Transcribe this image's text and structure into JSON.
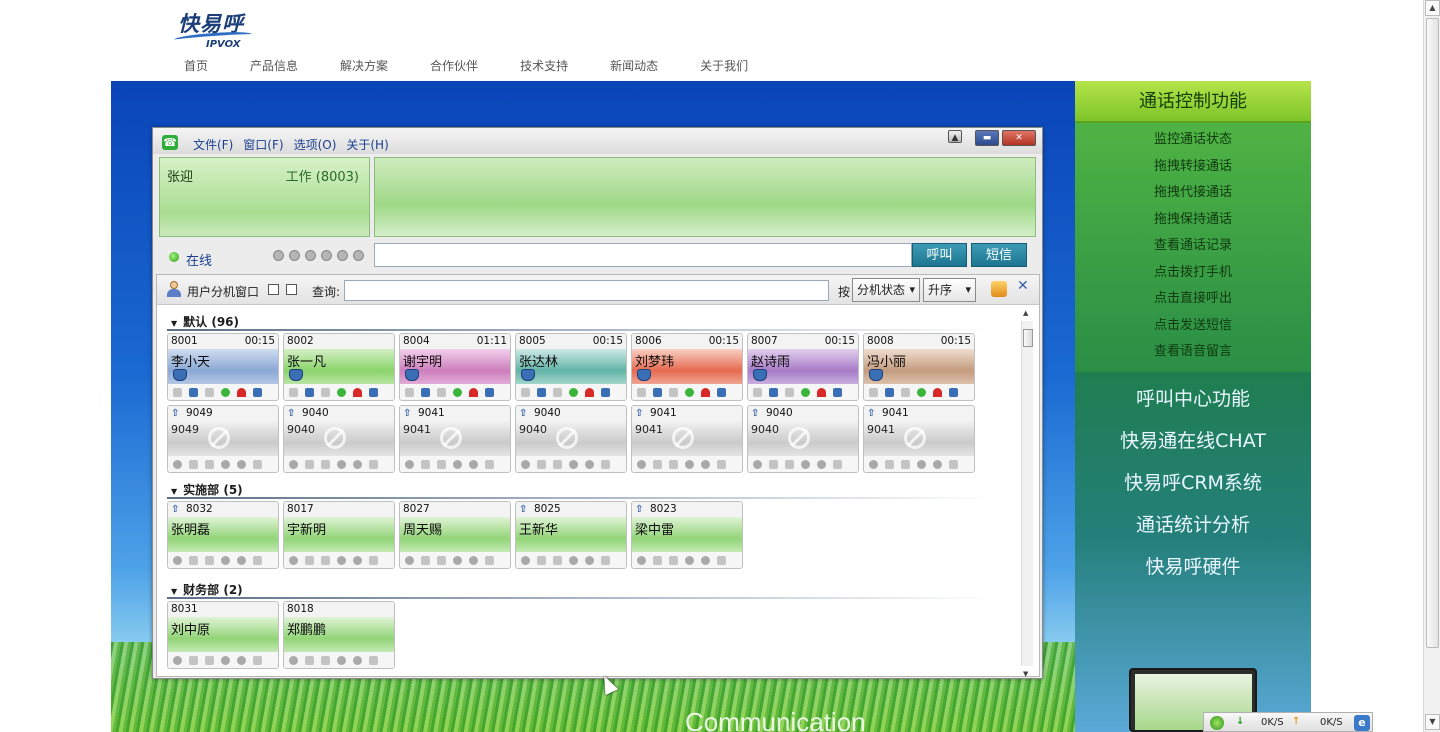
{
  "site": {
    "logo_text": "快易呼",
    "logo_sub": "IPVOX",
    "nav": [
      "首页",
      "产品信息",
      "解决方案",
      "合作伙伴",
      "技术支持",
      "新闻动态",
      "关于我们"
    ]
  },
  "hero": {
    "overlay_text": "Communication"
  },
  "right_panel": {
    "title": "通话控制功能",
    "sub_items": [
      "监控通话状态",
      "拖拽转接通话",
      "拖拽代接通话",
      "拖拽保持通话",
      "查看通话记录",
      "点击拨打手机",
      "点击直接呼出",
      "点击发送短信",
      "查看语音留言"
    ],
    "big_items": [
      "呼叫中心功能",
      "快易通在线CHAT",
      "快易呼CRM系统",
      "通话统计分析",
      "快易呼硬件"
    ]
  },
  "app": {
    "menu": [
      "文件(F)",
      "窗口(F)",
      "选项(O)",
      "关于(H)"
    ],
    "window_buttons": {
      "minimize": "▬",
      "close": "✕",
      "restore": "▲"
    },
    "user": {
      "name": "张迎",
      "status": "工作 (8003)"
    },
    "presence": "在线",
    "call_button": "呼叫",
    "sms_button": "短信"
  },
  "ext_panel": {
    "title": "用户分机窗口",
    "query_label": "查询:",
    "by_label": "按",
    "sort_field": "分机状态",
    "sort_order": "升序",
    "close": "✕",
    "groups": [
      {
        "header": "默认 (96)",
        "cards": [
          {
            "ext": "8001",
            "time": "00:15",
            "name": "李小天",
            "color": "blue",
            "active": true
          },
          {
            "ext": "8002",
            "time": "",
            "name": "张一凡",
            "color": "green",
            "active": true
          },
          {
            "ext": "8004",
            "time": "01:11",
            "name": "谢宇明",
            "color": "pink",
            "active": true
          },
          {
            "ext": "8005",
            "time": "00:15",
            "name": "张达林",
            "color": "teal",
            "active": true
          },
          {
            "ext": "8006",
            "time": "00:15",
            "name": "刘梦玮",
            "color": "red",
            "active": true
          },
          {
            "ext": "8007",
            "time": "00:15",
            "name": "赵诗雨",
            "color": "purple",
            "active": true
          },
          {
            "ext": "8008",
            "time": "00:15",
            "name": "冯小丽",
            "color": "tan",
            "active": true
          },
          {
            "ext": "9049",
            "name": "9049",
            "color": "grey",
            "active": false
          },
          {
            "ext": "9040",
            "name": "9040",
            "color": "grey",
            "active": false
          },
          {
            "ext": "9041",
            "name": "9041",
            "color": "grey",
            "active": false
          },
          {
            "ext": "9040",
            "name": "9040",
            "color": "grey",
            "active": false
          },
          {
            "ext": "9041",
            "name": "9041",
            "color": "grey",
            "active": false
          },
          {
            "ext": "9040",
            "name": "9040",
            "color": "grey",
            "active": false
          },
          {
            "ext": "9041",
            "name": "9041",
            "color": "grey",
            "active": false
          }
        ]
      },
      {
        "header": "实施部 (5)",
        "cards": [
          {
            "ext": "8032",
            "name": "张明磊",
            "color": "lgreen",
            "arrow": true
          },
          {
            "ext": "8017",
            "name": "宇新明",
            "color": "lgreen",
            "arrow": false
          },
          {
            "ext": "8027",
            "name": "周天赐",
            "color": "lgreen",
            "arrow": false
          },
          {
            "ext": "8025",
            "name": "王新华",
            "color": "lgreen",
            "arrow": true
          },
          {
            "ext": "8023",
            "name": "梁中雷",
            "color": "lgreen",
            "arrow": true
          }
        ]
      },
      {
        "header": "财务部 (2)",
        "cards": [
          {
            "ext": "8031",
            "name": "刘中原",
            "color": "lgreen",
            "arrow": false
          },
          {
            "ext": "8018",
            "name": "郑鹏鹏",
            "color": "lgreen",
            "arrow": false
          }
        ]
      }
    ]
  },
  "netbar": {
    "down": "0K/S",
    "up": "0K/S",
    "down_arrow": "↓",
    "up_arrow": "↑",
    "ie": "e"
  },
  "scrollbar": {
    "up": "▲",
    "down": "▼"
  }
}
